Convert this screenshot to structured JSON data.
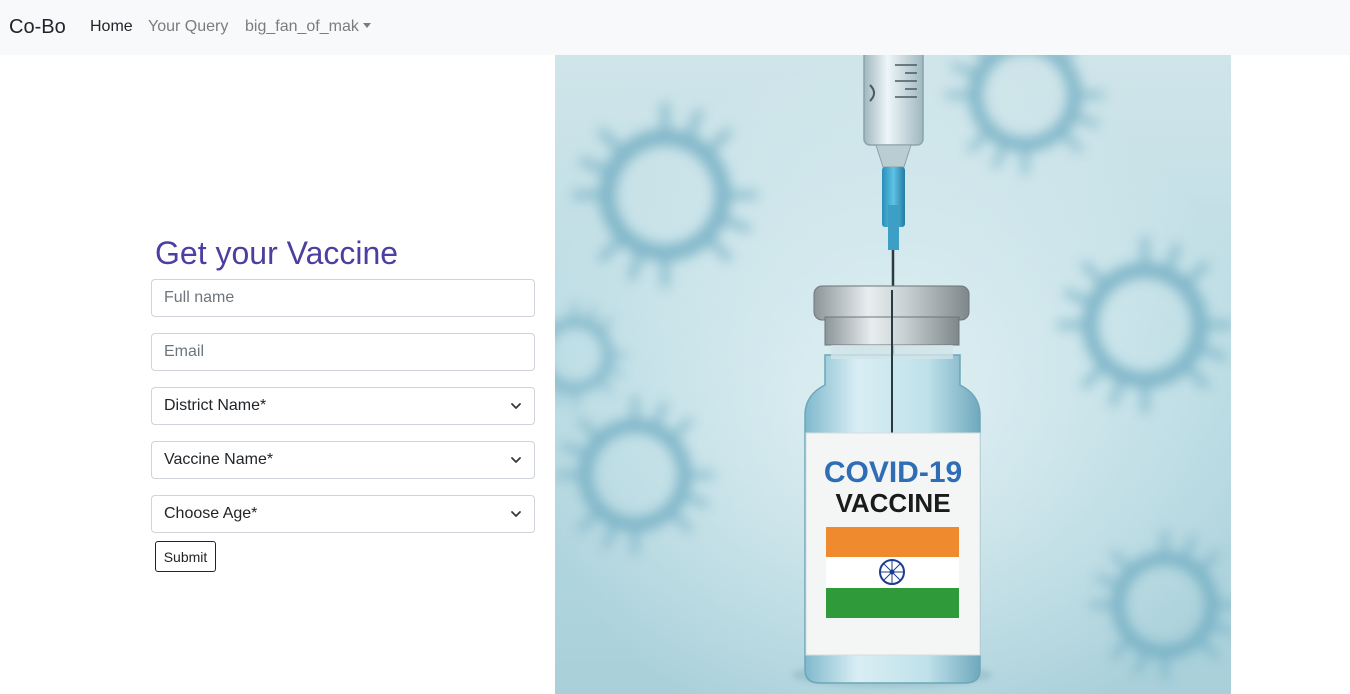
{
  "nav": {
    "brand": "Co-Bo",
    "home": "Home",
    "query": "Your Query",
    "user": "big_fan_of_mak"
  },
  "form": {
    "title": "Get your Vaccine",
    "full_name_placeholder": "Full name",
    "email_placeholder": "Email",
    "district": "District Name*",
    "vaccine": "Vaccine Name*",
    "age": "Choose Age*",
    "submit": "Submit"
  },
  "hero": {
    "line1": "COVID-19",
    "line2": "VACCINE"
  },
  "colors": {
    "navbar_bg": "#f8f9fa",
    "title": "#4b3fa0",
    "saffron": "#f08a2e",
    "green": "#2e9a3a",
    "label_blue": "#2f6db5"
  }
}
